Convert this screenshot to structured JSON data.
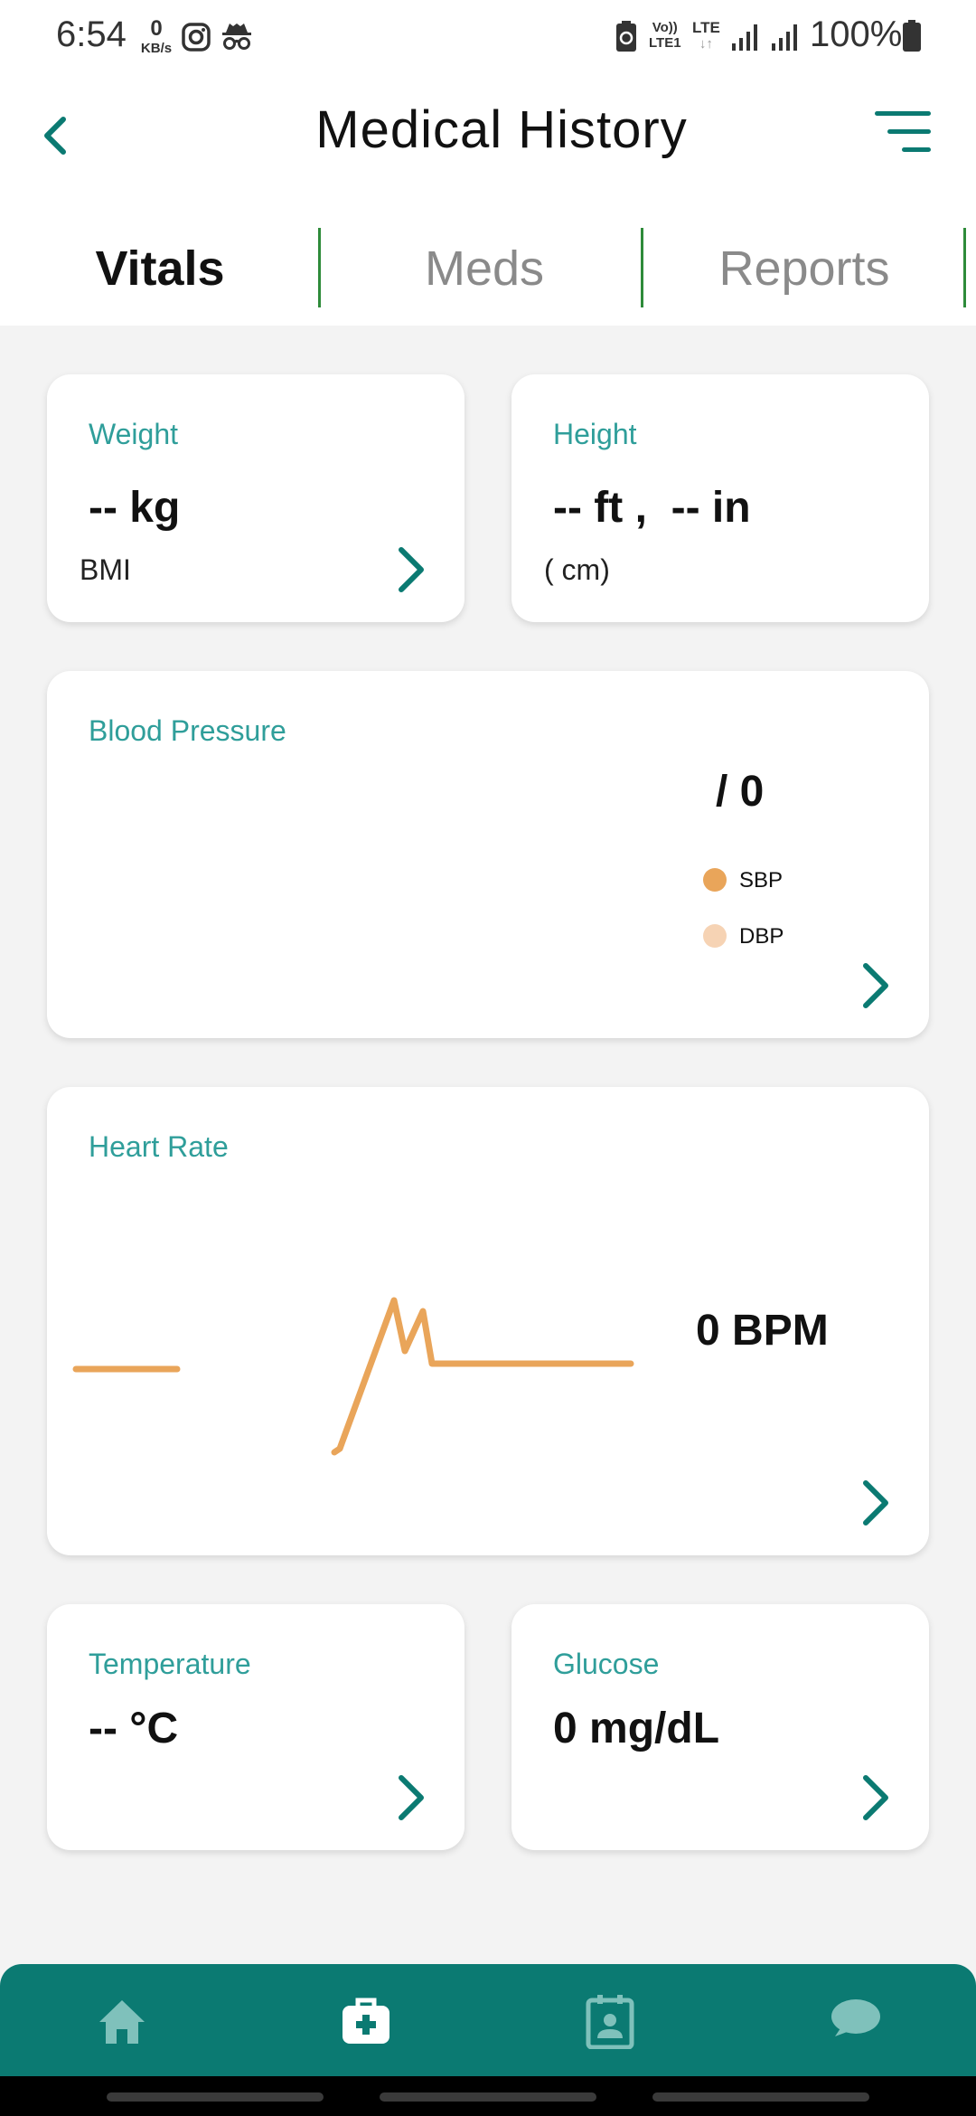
{
  "status_bar": {
    "time": "6:54",
    "net_speed_value": "0",
    "net_speed_unit": "KB/s",
    "volte_line1": "Vo))",
    "volte_line2": "LTE1",
    "lte_label": "LTE",
    "lte_arrows": "↓↑",
    "battery_pct": "100%",
    "icons": [
      "instagram-icon",
      "incognito-icon",
      "battery-saver-icon",
      "signal-icon",
      "signal-icon",
      "battery-icon"
    ]
  },
  "header": {
    "title": "Medical History",
    "back_icon": "chevron-left-icon",
    "menu_icon": "filter-menu-icon"
  },
  "tabs": [
    {
      "label": "Vitals",
      "active": true
    },
    {
      "label": "Meds",
      "active": false
    },
    {
      "label": "Reports",
      "active": false
    }
  ],
  "cards": {
    "weight": {
      "label": "Weight",
      "value": "-- kg",
      "sub": "BMI"
    },
    "height": {
      "label": "Height",
      "value": "-- ft ,  -- in",
      "sub": "( cm)"
    },
    "blood_pressure": {
      "label": "Blood Pressure",
      "value": "/ 0",
      "legend": [
        {
          "name": "SBP",
          "color": "#e9a55a"
        },
        {
          "name": "DBP",
          "color": "#f6d3b4"
        }
      ]
    },
    "heart_rate": {
      "label": "Heart Rate",
      "value": "0 BPM",
      "line_color": "#e9a55a"
    },
    "temperature": {
      "label": "Temperature",
      "value": "-- °C"
    },
    "glucose": {
      "label": "Glucose",
      "value": "0 mg/dL"
    }
  },
  "bottom_nav": {
    "items": [
      "home-icon",
      "medical-kit-icon",
      "calendar-user-icon",
      "chat-icon"
    ],
    "active_index": 1,
    "bg_color": "#0b7a72"
  },
  "colors": {
    "accent": "#0b7a72",
    "label_teal": "#2f9e9a",
    "tab_divider": "#2e8b3a"
  }
}
